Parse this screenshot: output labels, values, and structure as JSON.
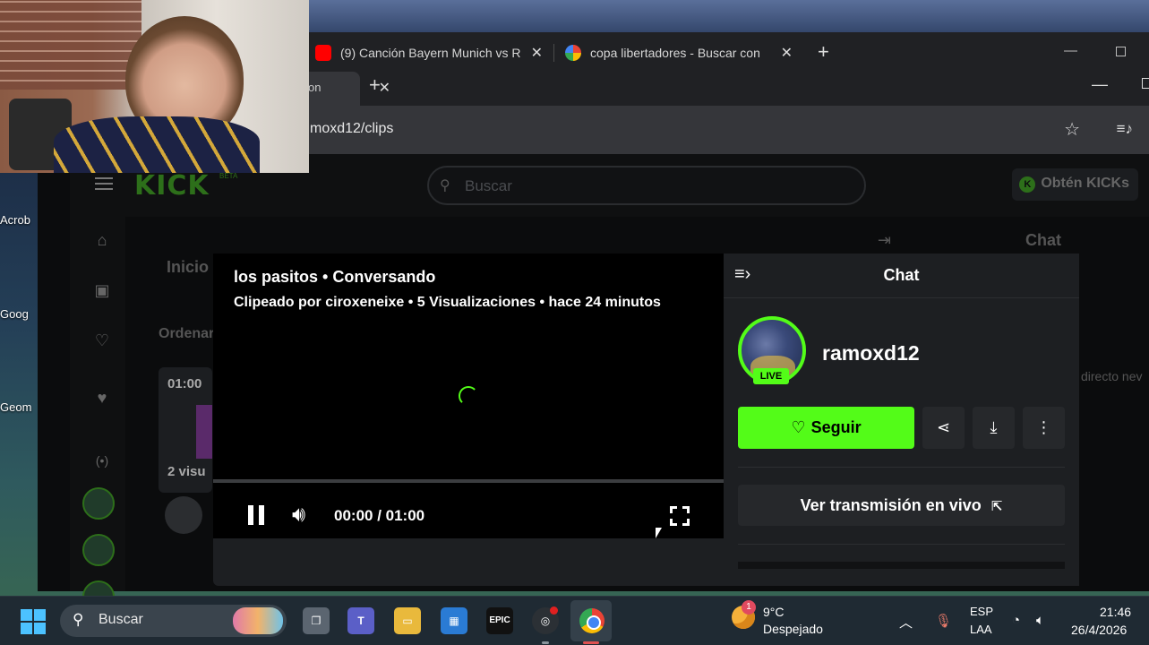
{
  "desktop": {
    "icons": [
      "Acrob",
      "Goog",
      "Geom"
    ]
  },
  "back_browser": {
    "tabs": [
      {
        "title": "(9) Canción Bayern Munich vs R",
        "favicon": "youtube-icon"
      },
      {
        "title": "copa libertadores - Buscar con",
        "favicon": "google-icon"
      }
    ]
  },
  "front_browser": {
    "tab_fragment": "on",
    "url": "moxd12/clips"
  },
  "kick": {
    "logo": "KICK",
    "logo_badge": "BETA",
    "search_placeholder": "Buscar",
    "get_kicks": "Obtén KICKs",
    "bg_tab_label": "Inicio",
    "bg_sort_label": "Ordenar",
    "bg_card_duration": "01:00",
    "bg_card_views": "2 visu",
    "bg_chat_title": "Chat",
    "bg_live_text": "directo nev"
  },
  "clip": {
    "title": "los pasitos • Conversando",
    "meta": "Clipeado por ciroxeneixe • 5 Visualizaciones • hace 24 minutos",
    "time": "00:00 / 01:00",
    "progress": 0
  },
  "chat": {
    "title": "Chat",
    "channel": "ramoxd12",
    "live_badge": "LIVE",
    "follow_label": "Seguir",
    "watch_live_label": "Ver transmisión en vivo"
  },
  "taskbar": {
    "search_label": "Buscar",
    "weather_badge": "1",
    "temperature": "9°C",
    "condition": "Despejado",
    "lang": "ESP",
    "layout": "LAA",
    "time": "21:46",
    "date": "26/4/2026"
  },
  "colors": {
    "kick_green": "#53fc18",
    "taskbar": "#1f2a33",
    "browser_dark": "#202124"
  }
}
